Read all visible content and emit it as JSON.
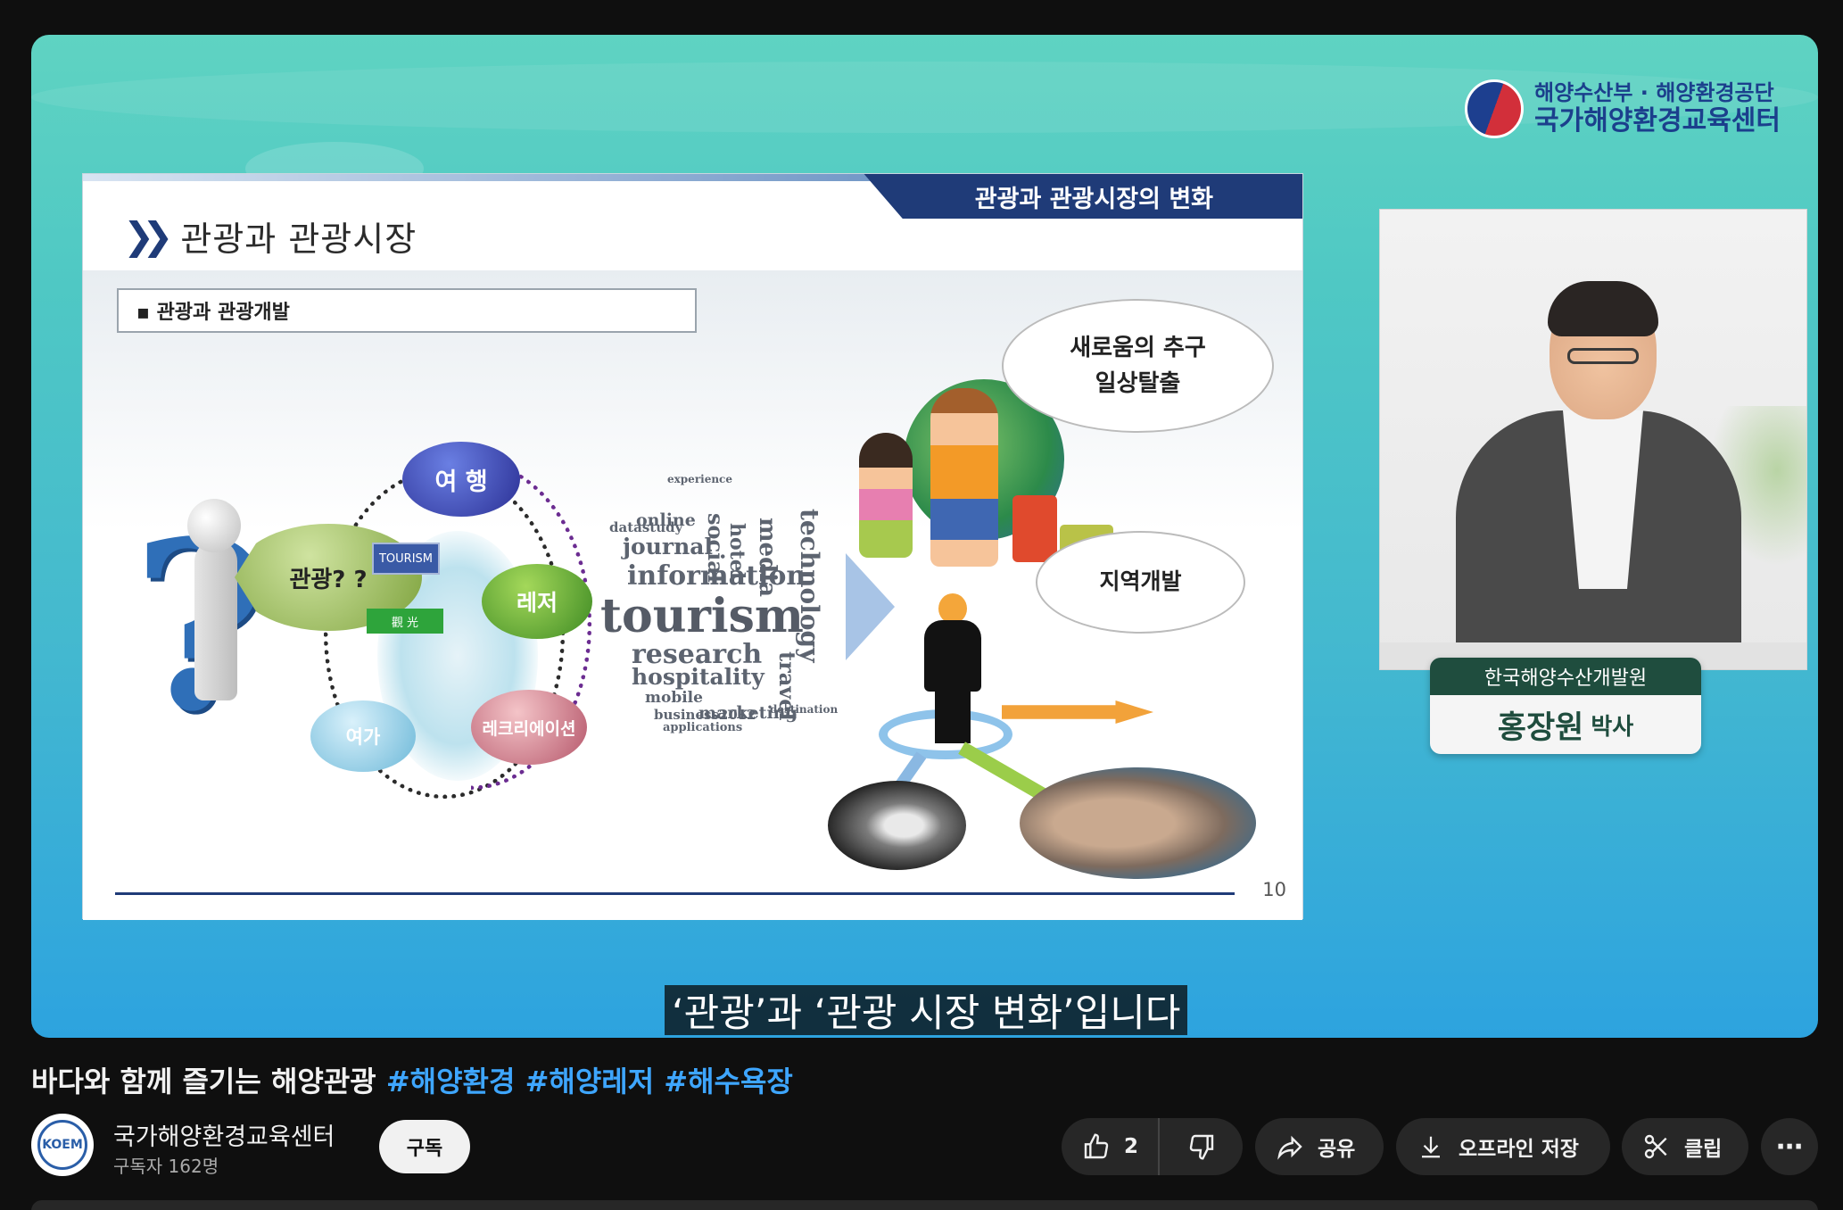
{
  "sponsor": {
    "line1": "해양수산부 · 해양환경공단",
    "line2": "국가해양환경교육센터"
  },
  "slide": {
    "tab_title": "관광과 관광시장의 변화",
    "title": "관광과 관광시장",
    "subtitle": "▪ 관광과 관광개발",
    "page_number": "10",
    "diagram": {
      "center": "관광? ?",
      "travel": "여 행",
      "leisure": "레저",
      "free_time": "여가",
      "recreation": "레크리에이션",
      "tag_tourism": "TOURISM",
      "tag_gwan": "觀 光"
    },
    "word_cloud": [
      "tourism",
      "information",
      "research",
      "hospitality",
      "technology",
      "marketing",
      "journal",
      "social",
      "media",
      "travel",
      "online",
      "datastudy",
      "hotel",
      "mobile",
      "business2012",
      "applications",
      "experience",
      "destination"
    ],
    "speech1_line1": "새로움의  추구",
    "speech1_line2": "일상탈출",
    "speech2": "지역개발"
  },
  "presenter": {
    "org": "한국해양수산개발원",
    "name": "홍장원",
    "title": "박사"
  },
  "caption": "‘관광’과 ‘관광 시장 변화’입니다",
  "video": {
    "title": "바다와 함께 즐기는 해양관광",
    "hashtags": [
      "#해양환경",
      "#해양레저",
      "#해수욕장"
    ]
  },
  "channel": {
    "avatar_text": "KOEM",
    "name": "국가해양환경교육센터",
    "subscribers": "구독자 162명",
    "subscribe_label": "구독"
  },
  "actions": {
    "like_count": "2",
    "share": "공유",
    "download": "오프라인 저장",
    "clip": "클립",
    "more": "⋯"
  },
  "icons": {
    "like": "thumbs-up-icon",
    "dislike": "thumbs-down-icon",
    "share": "share-arrow-icon",
    "download": "download-icon",
    "clip": "scissors-icon",
    "more": "more-horizontal-icon"
  },
  "colors": {
    "accent_link": "#3ea6ff",
    "slide_navy": "#1f3b78",
    "nameplate_green": "#1f4d3e"
  }
}
